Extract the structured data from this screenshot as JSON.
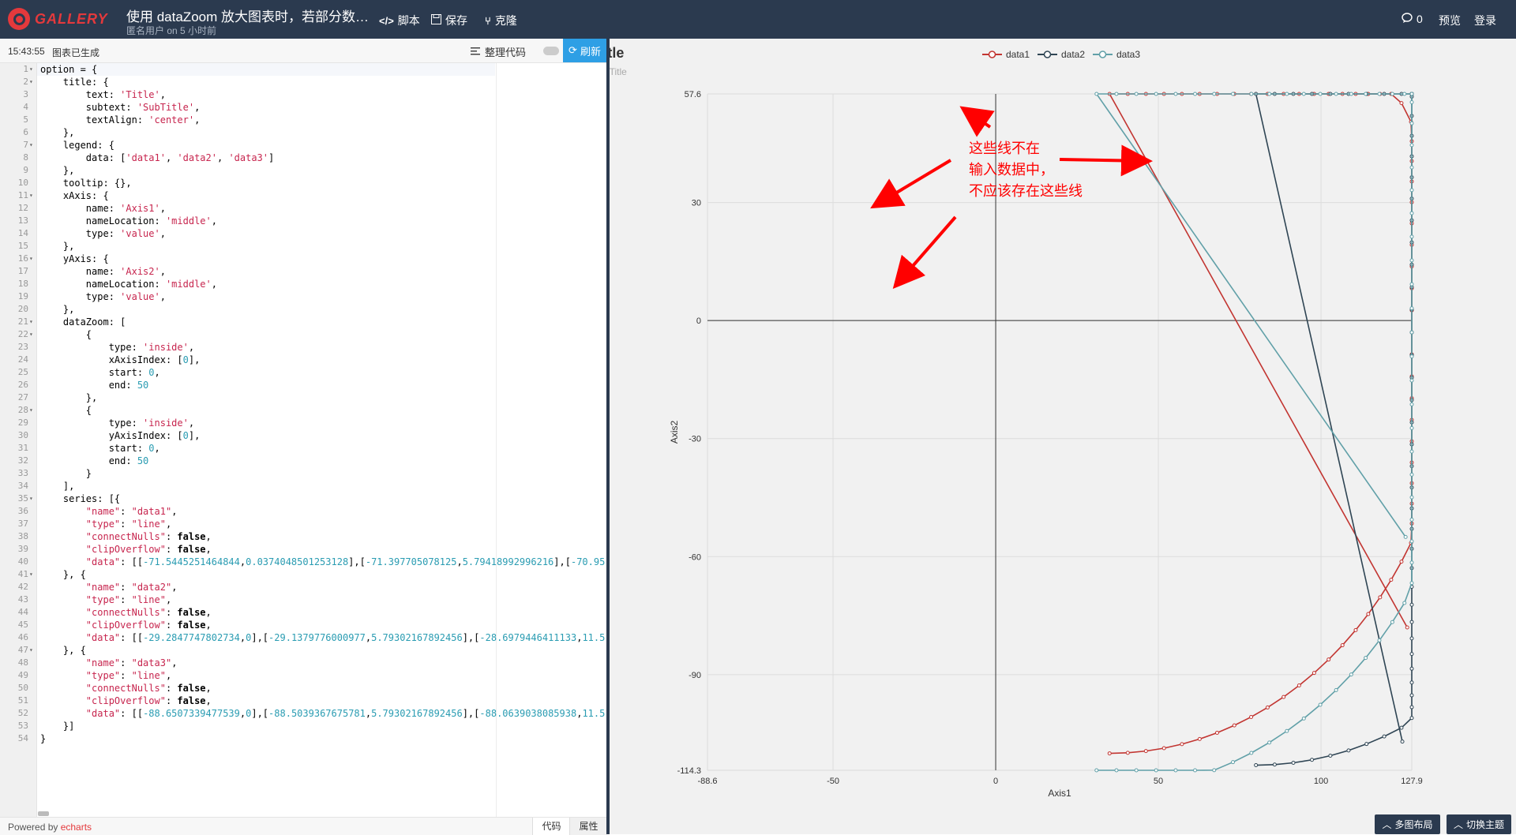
{
  "header": {
    "logo_text": "GALLERY",
    "title": "使用 dataZoom 放大图表时，若部分数…",
    "meta": "匿名用户 on 5 小时前",
    "script_label": "脚本",
    "save_label": "保存",
    "clone_label": "克隆",
    "comment_count": "0",
    "preview_label": "预览",
    "login_label": "登录"
  },
  "status": {
    "time": "15:43:55",
    "message": "图表已生成",
    "format_label": "整理代码",
    "refresh_label": "刷新"
  },
  "editor": {
    "lines": [
      {
        "n": "1",
        "fold": "▾",
        "html": "option = {"
      },
      {
        "n": "2",
        "fold": "▾",
        "html": "    title: {"
      },
      {
        "n": "3",
        "fold": "",
        "html": "        text: <span class=\"s\">'Title'</span>,"
      },
      {
        "n": "4",
        "fold": "",
        "html": "        subtext: <span class=\"s\">'SubTitle'</span>,"
      },
      {
        "n": "5",
        "fold": "",
        "html": "        textAlign: <span class=\"s\">'center'</span>,"
      },
      {
        "n": "6",
        "fold": "",
        "html": "    },"
      },
      {
        "n": "7",
        "fold": "▾",
        "html": "    legend: {"
      },
      {
        "n": "8",
        "fold": "",
        "html": "        data: [<span class=\"s\">'data1'</span>, <span class=\"s\">'data2'</span>, <span class=\"s\">'data3'</span>]"
      },
      {
        "n": "9",
        "fold": "",
        "html": "    },"
      },
      {
        "n": "10",
        "fold": "",
        "html": "    tooltip: {},"
      },
      {
        "n": "11",
        "fold": "▾",
        "html": "    xAxis: {"
      },
      {
        "n": "12",
        "fold": "",
        "html": "        name: <span class=\"s\">'Axis1'</span>,"
      },
      {
        "n": "13",
        "fold": "",
        "html": "        nameLocation: <span class=\"s\">'middle'</span>,"
      },
      {
        "n": "14",
        "fold": "",
        "html": "        type: <span class=\"s\">'value'</span>,"
      },
      {
        "n": "15",
        "fold": "",
        "html": "    },"
      },
      {
        "n": "16",
        "fold": "▾",
        "html": "    yAxis: {"
      },
      {
        "n": "17",
        "fold": "",
        "html": "        name: <span class=\"s\">'Axis2'</span>,"
      },
      {
        "n": "18",
        "fold": "",
        "html": "        nameLocation: <span class=\"s\">'middle'</span>,"
      },
      {
        "n": "19",
        "fold": "",
        "html": "        type: <span class=\"s\">'value'</span>,"
      },
      {
        "n": "20",
        "fold": "",
        "html": "    },"
      },
      {
        "n": "21",
        "fold": "▾",
        "html": "    dataZoom: ["
      },
      {
        "n": "22",
        "fold": "▾",
        "html": "        {"
      },
      {
        "n": "23",
        "fold": "",
        "html": "            type: <span class=\"s\">'inside'</span>,"
      },
      {
        "n": "24",
        "fold": "",
        "html": "            xAxisIndex: [<span class=\"k\">0</span>],"
      },
      {
        "n": "25",
        "fold": "",
        "html": "            start: <span class=\"k\">0</span>,"
      },
      {
        "n": "26",
        "fold": "",
        "html": "            end: <span class=\"k\">50</span>"
      },
      {
        "n": "27",
        "fold": "",
        "html": "        },"
      },
      {
        "n": "28",
        "fold": "▾",
        "html": "        {"
      },
      {
        "n": "29",
        "fold": "",
        "html": "            type: <span class=\"s\">'inside'</span>,"
      },
      {
        "n": "30",
        "fold": "",
        "html": "            yAxisIndex: [<span class=\"k\">0</span>],"
      },
      {
        "n": "31",
        "fold": "",
        "html": "            start: <span class=\"k\">0</span>,"
      },
      {
        "n": "32",
        "fold": "",
        "html": "            end: <span class=\"k\">50</span>"
      },
      {
        "n": "33",
        "fold": "",
        "html": "        }"
      },
      {
        "n": "34",
        "fold": "",
        "html": "    ],"
      },
      {
        "n": "35",
        "fold": "▾",
        "html": "    series: [{"
      },
      {
        "n": "36",
        "fold": "",
        "html": "        <span class=\"s\">\"name\"</span>: <span class=\"s\">\"data1\"</span>,"
      },
      {
        "n": "37",
        "fold": "",
        "html": "        <span class=\"s\">\"type\"</span>: <span class=\"s\">\"line\"</span>,"
      },
      {
        "n": "38",
        "fold": "",
        "html": "        <span class=\"s\">\"connectNulls\"</span>: <span class=\"b\">false</span>,"
      },
      {
        "n": "39",
        "fold": "",
        "html": "        <span class=\"s\">\"clipOverflow\"</span>: <span class=\"b\">false</span>,"
      },
      {
        "n": "40",
        "fold": "",
        "html": "        <span class=\"s\">\"data\"</span>: [[<span class=\"k\">-71.5445251464844</span>,<span class=\"k\">0.0374048501253128</span>],[<span class=\"k\">-71.397705078125</span>,<span class=\"k\">5.79418992996216</span>],[<span class=\"k\">-70.95</span>"
      },
      {
        "n": "41",
        "fold": "▾",
        "html": "    }, {"
      },
      {
        "n": "42",
        "fold": "",
        "html": "        <span class=\"s\">\"name\"</span>: <span class=\"s\">\"data2\"</span>,"
      },
      {
        "n": "43",
        "fold": "",
        "html": "        <span class=\"s\">\"type\"</span>: <span class=\"s\">\"line\"</span>,"
      },
      {
        "n": "44",
        "fold": "",
        "html": "        <span class=\"s\">\"connectNulls\"</span>: <span class=\"b\">false</span>,"
      },
      {
        "n": "45",
        "fold": "",
        "html": "        <span class=\"s\">\"clipOverflow\"</span>: <span class=\"b\">false</span>,"
      },
      {
        "n": "46",
        "fold": "",
        "html": "        <span class=\"s\">\"data\"</span>: [[<span class=\"k\">-29.2847747802734</span>,<span class=\"k\">0</span>],[<span class=\"k\">-29.1379776000977</span>,<span class=\"k\">5.79302167892456</span>],[<span class=\"k\">-28.6979446411133</span>,<span class=\"k\">11.5</span>"
      },
      {
        "n": "47",
        "fold": "▾",
        "html": "    }, {"
      },
      {
        "n": "48",
        "fold": "",
        "html": "        <span class=\"s\">\"name\"</span>: <span class=\"s\">\"data3\"</span>,"
      },
      {
        "n": "49",
        "fold": "",
        "html": "        <span class=\"s\">\"type\"</span>: <span class=\"s\">\"line\"</span>,"
      },
      {
        "n": "50",
        "fold": "",
        "html": "        <span class=\"s\">\"connectNulls\"</span>: <span class=\"b\">false</span>,"
      },
      {
        "n": "51",
        "fold": "",
        "html": "        <span class=\"s\">\"clipOverflow\"</span>: <span class=\"b\">false</span>,"
      },
      {
        "n": "52",
        "fold": "",
        "html": "        <span class=\"s\">\"data\"</span>: [[<span class=\"k\">-88.6507339477539</span>,<span class=\"k\">0</span>],[<span class=\"k\">-88.5039367675781</span>,<span class=\"k\">5.79302167892456</span>],[<span class=\"k\">-88.0639038085938</span>,<span class=\"k\">11.5</span>"
      },
      {
        "n": "53",
        "fold": "",
        "html": "    }]"
      },
      {
        "n": "54",
        "fold": "",
        "html": "}"
      }
    ]
  },
  "footer": {
    "powered_prefix": "Powered by ",
    "powered_link": "echarts",
    "tab_code": "代码",
    "tab_props": "属性"
  },
  "bottom": {
    "layout_label": "多图布局",
    "theme_label": "切换主题"
  },
  "annotation": {
    "line1": "这些线不在",
    "line2": "输入数据中，",
    "line3": "不应该存在这些线"
  },
  "colors": {
    "data1": "#c23531",
    "data2": "#2f4554",
    "data3": "#61a0a8",
    "annotation": "#ff0000"
  },
  "chart_data": {
    "type": "line",
    "title": "Title",
    "subtitle": "SubTitle",
    "xlabel": "Axis1",
    "ylabel": "Axis2",
    "xlim": [
      -88.6,
      127.9
    ],
    "ylim": [
      -114.3,
      57.6
    ],
    "x_ticks": [
      "-88.6",
      "-50",
      "0",
      "50",
      "100",
      "127.9"
    ],
    "y_ticks": [
      "57.6",
      "30",
      "0",
      "-30",
      "-60",
      "-90",
      "-114.3"
    ],
    "legend": [
      "data1",
      "data2",
      "data3"
    ],
    "legend_position": "top-center",
    "grid": true,
    "series": [
      {
        "name": "data1",
        "color": "#c23531",
        "shape": "semicircle",
        "cx": 35,
        "cy": -3,
        "r": 107,
        "spurious_x": 126.5,
        "spurious_y": -78
      },
      {
        "name": "data2",
        "color": "#2f4554",
        "shape": "semicircle",
        "cx": 80,
        "cy": -3,
        "r": 110,
        "spurious_x": 125,
        "spurious_y": -107
      },
      {
        "name": "data3",
        "color": "#61a0a8",
        "shape": "semicircle",
        "cx": 31,
        "cy": -3,
        "r": 117,
        "spurious_x": 126,
        "spurious_y": -55
      }
    ]
  }
}
